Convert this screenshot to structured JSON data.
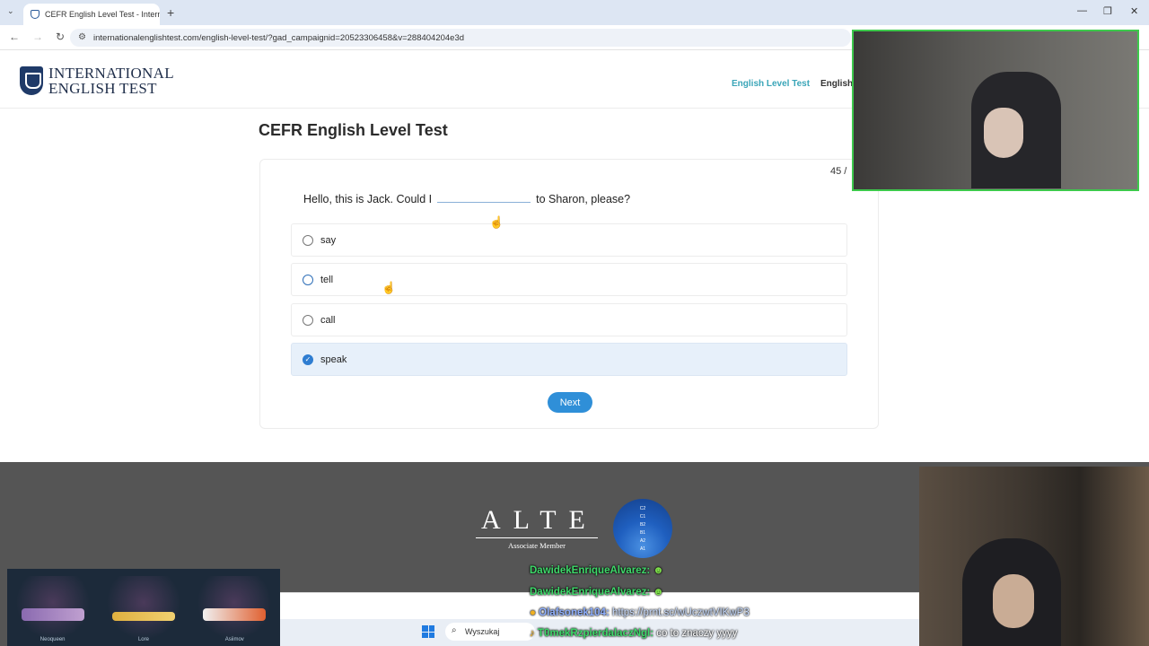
{
  "browser": {
    "tab_title": "CEFR English Level Test - Interna",
    "tab_close": "✕",
    "new_tab": "+",
    "url": "internationalenglishtest.com/english-level-test/?gad_campaignid=20523306458&v=288404204e3d",
    "window_controls": [
      "—",
      "❐",
      "✕"
    ]
  },
  "site": {
    "logo_line1": "INTERNATIONAL",
    "logo_line2": "ENGLISH TEST",
    "nav": [
      "English Level Test",
      "English"
    ]
  },
  "test": {
    "title": "CEFR English Level Test",
    "counter": "45 /",
    "question_before": "Hello, this is Jack. Could I",
    "question_after": "to Sharon, please?",
    "options": [
      {
        "label": "say",
        "selected": false
      },
      {
        "label": "tell",
        "selected": false
      },
      {
        "label": "call",
        "selected": false
      },
      {
        "label": "speak",
        "selected": true
      }
    ],
    "next_label": "Next"
  },
  "footer": {
    "alte_letters": "ALTE",
    "alte_sub": "Associate Member",
    "cefr_levels": [
      "C2",
      "C1",
      "B2",
      "B1",
      "A2",
      "A1"
    ]
  },
  "overlay": {
    "skins": [
      "Neoqueen",
      "Lore",
      "Asiimov"
    ],
    "chat": [
      {
        "user": "DawidekEnriqueAlvarez:",
        "msg": "☻"
      },
      {
        "user": "DawidekEnriqueAlvarez:",
        "msg": "☻"
      },
      {
        "user": "Olafsonek104:",
        "msg": "https://prnt.sc/wUczwtVIKwP3"
      },
      {
        "user": "T0mekRzpierdalaczNgl:",
        "msg": "co to znaczy yyyy"
      }
    ],
    "taskbar_search": "Wyszukaj"
  },
  "colors": {
    "accent": "#2f8fd8",
    "nav_active": "#3aa5b8",
    "webcam_border": "#3dc94c"
  }
}
